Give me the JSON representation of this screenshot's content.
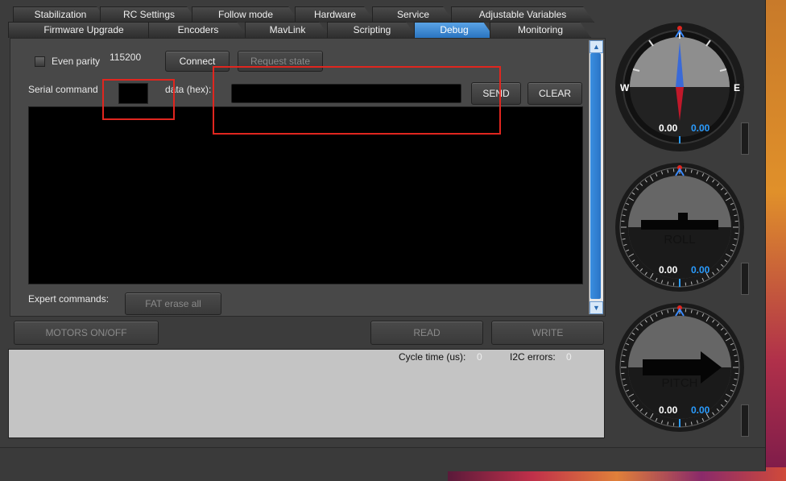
{
  "tabs_row1": [
    "Stabilization",
    "RC Settings",
    "Follow mode",
    "Hardware",
    "Service",
    "Adjustable Variables"
  ],
  "tabs_row2": [
    "Firmware Upgrade",
    "Encoders",
    "MavLink",
    "Scripting",
    "Debug",
    "Monitoring"
  ],
  "active_tab": "Debug",
  "debug": {
    "even_parity_label": "Even parity",
    "baud": "115200",
    "connect_label": "Connect",
    "request_state_label": "Request state",
    "serial_command_label": "Serial command",
    "serial_command_value": "",
    "data_hex_label": "data (hex):",
    "data_hex_value": "",
    "send_label": "SEND",
    "clear_label": "CLEAR",
    "expert_commands_label": "Expert commands:",
    "fat_erase_label": "FAT erase all"
  },
  "actions": {
    "motors_label": "MOTORS ON/OFF",
    "read_label": "READ",
    "write_label": "WRITE"
  },
  "status": {
    "cycle_time_label": "Cycle time (us):",
    "cycle_time_value": "0",
    "i2c_errors_label": "I2C errors:",
    "i2c_errors_value": "0"
  },
  "gauges": {
    "yaw": {
      "west": "W",
      "east": "E",
      "value1": "0.00",
      "value2": "0.00"
    },
    "roll": {
      "title": "ROLL",
      "value1": "0.00",
      "value2": "0.00"
    },
    "pitch": {
      "title": "PITCH",
      "value1": "0.00",
      "value2": "0.00"
    }
  },
  "colors": {
    "accent": "#2a7ad0",
    "highlight_box": "#e0261f",
    "value_blue": "#2a9cff"
  }
}
